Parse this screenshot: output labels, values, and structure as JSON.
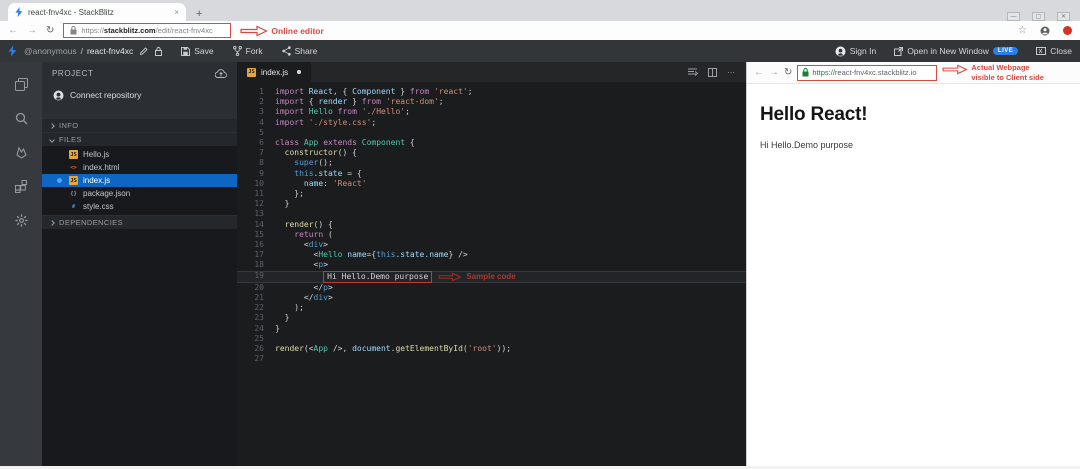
{
  "browser": {
    "tab_title": "react-fnv4xc - StackBlitz",
    "url_scheme": "https://",
    "url_host": "stackblitz.com",
    "url_path": "/edit/react-fnv4xc"
  },
  "annotations": {
    "online_editor": "Online editor",
    "actual_webpage_line1": "Actual Webpage",
    "actual_webpage_line2": "visible to Client side",
    "sample_code": "Sample code",
    "accent_color": "#d84a41"
  },
  "app_header": {
    "breadcrumb_user": "@anonymous",
    "breadcrumb_sep": "/",
    "breadcrumb_project": "react-fnv4xc",
    "save_label": "Save",
    "fork_label": "Fork",
    "share_label": "Share",
    "sign_in_label": "Sign In",
    "open_new_window_label": "Open in New Window",
    "live_badge": "LIVE",
    "close_label": "Close"
  },
  "sidebar": {
    "panel_title": "PROJECT",
    "connect_label": "Connect repository",
    "sections": {
      "info": "INFO",
      "files": "FILES",
      "dependencies": "DEPENDENCIES"
    },
    "activity_icons": [
      "files-icon",
      "search-icon",
      "deploy-icon",
      "extensions-icon",
      "settings-icon"
    ],
    "files": [
      {
        "name": "Hello.js",
        "icon": "js",
        "selected": false,
        "modified": false
      },
      {
        "name": "index.html",
        "icon": "html",
        "selected": false,
        "modified": false
      },
      {
        "name": "index.js",
        "icon": "js",
        "selected": true,
        "modified": true
      },
      {
        "name": "package.json",
        "icon": "json",
        "selected": false,
        "modified": false
      },
      {
        "name": "style.css",
        "icon": "css",
        "selected": false,
        "modified": false
      }
    ]
  },
  "editor": {
    "tab_label": "index.js",
    "tab_modified": true,
    "annotated_line": 19,
    "lines": [
      [
        [
          "kw",
          "import"
        ],
        [
          "pn",
          " "
        ],
        [
          "id",
          "React"
        ],
        [
          "pn",
          ", { "
        ],
        [
          "id",
          "Component"
        ],
        [
          "pn",
          " } "
        ],
        [
          "kw",
          "from"
        ],
        [
          "pn",
          " "
        ],
        [
          "st",
          "'react'"
        ],
        [
          "pn",
          ";"
        ]
      ],
      [
        [
          "kw",
          "import"
        ],
        [
          "pn",
          " { "
        ],
        [
          "id",
          "render"
        ],
        [
          "pn",
          " } "
        ],
        [
          "kw",
          "from"
        ],
        [
          "pn",
          " "
        ],
        [
          "st",
          "'react-dom'"
        ],
        [
          "pn",
          ";"
        ]
      ],
      [
        [
          "kw",
          "import"
        ],
        [
          "pn",
          " "
        ],
        [
          "ty",
          "Hello"
        ],
        [
          "pn",
          " "
        ],
        [
          "kw",
          "from"
        ],
        [
          "pn",
          " "
        ],
        [
          "st",
          "'./Hello'"
        ],
        [
          "pn",
          ";"
        ]
      ],
      [
        [
          "kw",
          "import"
        ],
        [
          "pn",
          " "
        ],
        [
          "st",
          "'./style.css'"
        ],
        [
          "pn",
          ";"
        ]
      ],
      [],
      [
        [
          "kw",
          "class"
        ],
        [
          "pn",
          " "
        ],
        [
          "ty",
          "App"
        ],
        [
          "pn",
          " "
        ],
        [
          "kw",
          "extends"
        ],
        [
          "pn",
          " "
        ],
        [
          "ty",
          "Component"
        ],
        [
          "pn",
          " {"
        ]
      ],
      [
        [
          "pn",
          "  "
        ],
        [
          "fn",
          "constructor"
        ],
        [
          "pn",
          "() {"
        ]
      ],
      [
        [
          "pn",
          "    "
        ],
        [
          "bl",
          "super"
        ],
        [
          "pn",
          "();"
        ]
      ],
      [
        [
          "pn",
          "    "
        ],
        [
          "bl",
          "this"
        ],
        [
          "pn",
          "."
        ],
        [
          "id",
          "state"
        ],
        [
          "pn",
          " = {"
        ]
      ],
      [
        [
          "pn",
          "      "
        ],
        [
          "id",
          "name"
        ],
        [
          "pn",
          ": "
        ],
        [
          "st",
          "'React'"
        ]
      ],
      [
        [
          "pn",
          "    };"
        ]
      ],
      [
        [
          "pn",
          "  }"
        ]
      ],
      [],
      [
        [
          "pn",
          "  "
        ],
        [
          "fn",
          "render"
        ],
        [
          "pn",
          "() {"
        ]
      ],
      [
        [
          "pn",
          "    "
        ],
        [
          "kw",
          "return"
        ],
        [
          "pn",
          " ("
        ]
      ],
      [
        [
          "pn",
          "      <"
        ],
        [
          "tg",
          "div"
        ],
        [
          "pn",
          ">"
        ]
      ],
      [
        [
          "pn",
          "        <"
        ],
        [
          "ty",
          "Hello"
        ],
        [
          "pn",
          " "
        ],
        [
          "at",
          "name"
        ],
        [
          "pn",
          "={"
        ],
        [
          "bl",
          "this"
        ],
        [
          "pn",
          "."
        ],
        [
          "id",
          "state"
        ],
        [
          "pn",
          "."
        ],
        [
          "id",
          "name"
        ],
        [
          "pn",
          "} />"
        ]
      ],
      [
        [
          "pn",
          "        <"
        ],
        [
          "tg",
          "p"
        ],
        [
          "pn",
          ">"
        ]
      ],
      [
        [
          "pn",
          "          "
        ],
        [
          "tx",
          "Hi Hello.Demo purpose"
        ]
      ],
      [
        [
          "pn",
          "        </"
        ],
        [
          "tg",
          "p"
        ],
        [
          "pn",
          ">"
        ]
      ],
      [
        [
          "pn",
          "      </"
        ],
        [
          "tg",
          "div"
        ],
        [
          "pn",
          ">"
        ]
      ],
      [
        [
          "pn",
          "    );"
        ]
      ],
      [
        [
          "pn",
          "  }"
        ]
      ],
      [
        [
          "pn",
          "}"
        ]
      ],
      [],
      [
        [
          "fn",
          "render"
        ],
        [
          "pn",
          "(<"
        ],
        [
          "ty",
          "App"
        ],
        [
          "pn",
          " />, "
        ],
        [
          "id",
          "document"
        ],
        [
          "pn",
          "."
        ],
        [
          "fn",
          "getElementById"
        ],
        [
          "pn",
          "("
        ],
        [
          "st",
          "'root'"
        ],
        [
          "pn",
          "));"
        ]
      ],
      []
    ]
  },
  "preview": {
    "url_scheme": "https://",
    "url_host": "react-fnv4xc.stackblitz.io",
    "heading": "Hello React!",
    "body_text": "Hi Hello.Demo purpose"
  }
}
